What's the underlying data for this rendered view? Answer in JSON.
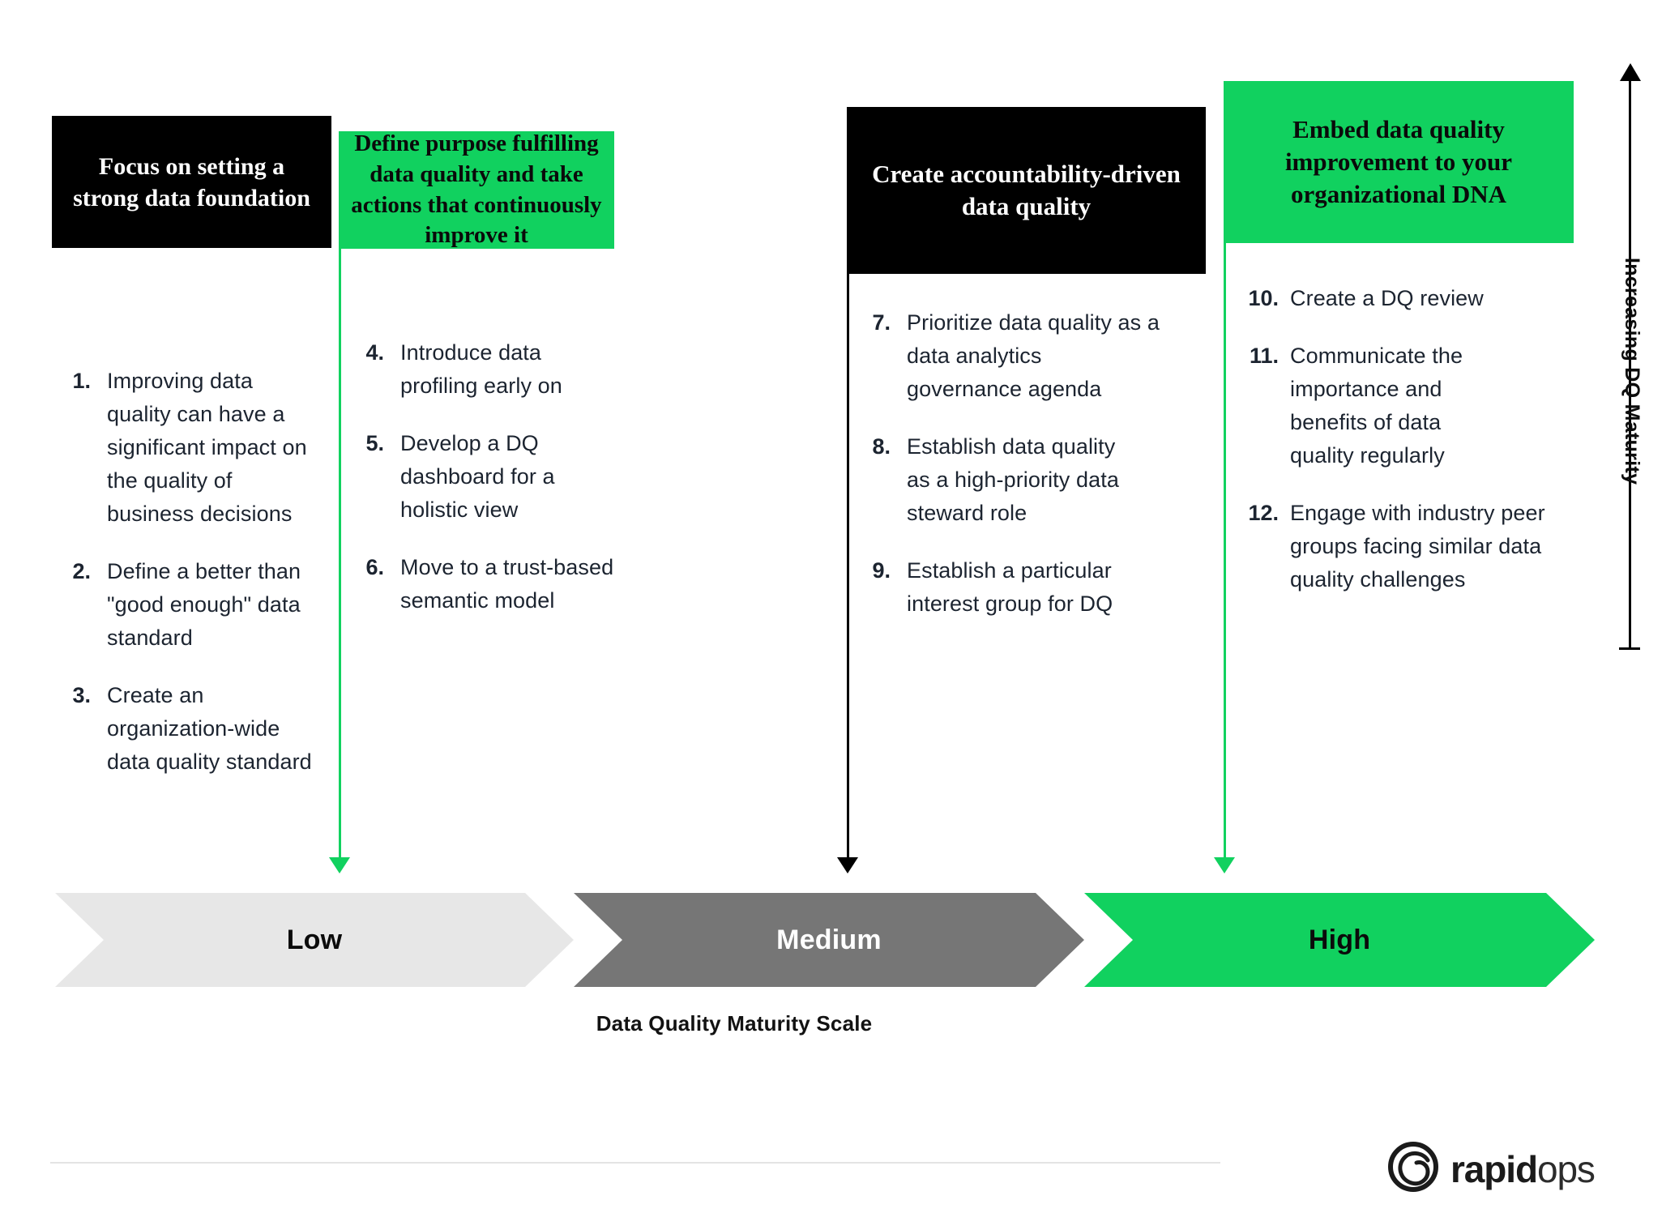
{
  "accent_green": "#11d15f",
  "ink": "#1c2430",
  "columns": [
    {
      "id": "stage-1",
      "header": "Focus on setting a strong data foundation",
      "header_style": "dark",
      "connector": "none",
      "items": [
        {
          "num": "1.",
          "text": "Improving data quality can have a significant impact on the quality of business decisions"
        },
        {
          "num": "2.",
          "text": "Define a better than \"good enough\" data standard"
        },
        {
          "num": "3.",
          "text": "Create an organization-wide data quality standard"
        }
      ]
    },
    {
      "id": "stage-2",
      "header": "Define purpose fulfilling data quality and take actions that continuously improve it",
      "header_style": "green",
      "connector": "green",
      "items": [
        {
          "num": "4.",
          "text": "Introduce data profiling early on"
        },
        {
          "num": "5.",
          "text": "Develop a DQ dashboard for a holistic view"
        },
        {
          "num": "6.",
          "text": "Move to a trust-based semantic model"
        }
      ]
    },
    {
      "id": "stage-3",
      "header": "Create accountability-driven data quality",
      "header_style": "dark",
      "connector": "black",
      "items": [
        {
          "num": "7.",
          "text": "Prioritize data quality as a data analytics governance agenda"
        },
        {
          "num": "8.",
          "text": "Establish data quality as a high-priority data steward role"
        },
        {
          "num": "9.",
          "text": "Establish a particular interest group for DQ"
        }
      ]
    },
    {
      "id": "stage-4",
      "header": "Embed data quality improvement to your organizational DNA",
      "header_style": "green",
      "connector": "green",
      "items": [
        {
          "num": "10.",
          "text": "Create a DQ review"
        },
        {
          "num": "11.",
          "text": "Communicate the importance and benefits of data quality regularly"
        },
        {
          "num": "12.",
          "text": "Engage with industry peer groups facing similar data quality challenges"
        }
      ]
    }
  ],
  "scale": {
    "caption": "Data Quality Maturity Scale",
    "steps": [
      {
        "label": "Low",
        "color": "#e7e7e7",
        "text_color": "#0b0b0b"
      },
      {
        "label": "Medium",
        "color": "#767676",
        "text_color": "#ffffff"
      },
      {
        "label": "High",
        "color": "#11d15f",
        "text_color": "#0b0b0b"
      }
    ]
  },
  "axis": {
    "label": "Increasing DQ Maturity",
    "direction_icon": "arrow-up-icon"
  },
  "footer": {
    "logo_mark": "rapidops-spiral-icon",
    "logo_bold": "rapid",
    "logo_light": "ops"
  }
}
